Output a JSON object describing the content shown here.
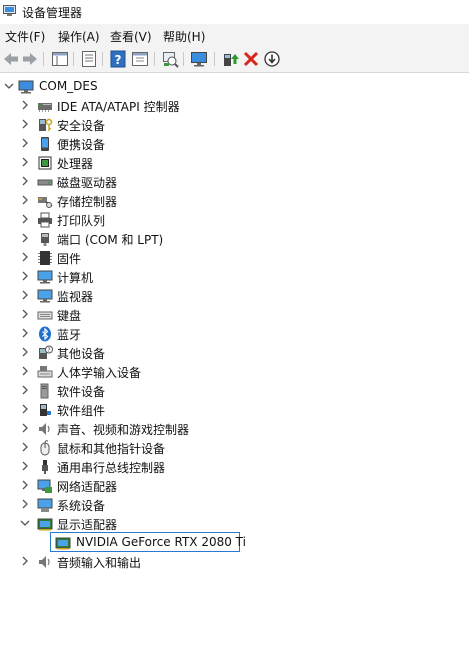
{
  "window": {
    "title": "设备管理器"
  },
  "menu": [
    "文件(F)",
    "操作(A)",
    "查看(V)",
    "帮助(H)"
  ],
  "toolbar": {
    "buttons": [
      "back-icon",
      "forward-icon",
      "show-hide-tree-icon",
      "properties-icon",
      "help-icon",
      "view-icon",
      "scan-hardware-icon",
      "monitor-icon",
      "update-driver-icon",
      "uninstall-icon",
      "disable-icon"
    ]
  },
  "tree": {
    "root": "COM_DES",
    "categories": [
      {
        "label": "IDE ATA/ATAPI 控制器",
        "icon": "ide-controller-icon"
      },
      {
        "label": "安全设备",
        "icon": "security-device-icon"
      },
      {
        "label": "便携设备",
        "icon": "portable-device-icon"
      },
      {
        "label": "处理器",
        "icon": "processor-icon"
      },
      {
        "label": "磁盘驱动器",
        "icon": "disk-drive-icon"
      },
      {
        "label": "存储控制器",
        "icon": "storage-controller-icon"
      },
      {
        "label": "打印队列",
        "icon": "print-queue-icon"
      },
      {
        "label": "端口 (COM 和 LPT)",
        "icon": "port-icon"
      },
      {
        "label": "固件",
        "icon": "firmware-icon"
      },
      {
        "label": "计算机",
        "icon": "computer-icon"
      },
      {
        "label": "监视器",
        "icon": "monitor-icon"
      },
      {
        "label": "键盘",
        "icon": "keyboard-icon"
      },
      {
        "label": "蓝牙",
        "icon": "bluetooth-icon"
      },
      {
        "label": "其他设备",
        "icon": "other-devices-icon"
      },
      {
        "label": "人体学输入设备",
        "icon": "hid-icon"
      },
      {
        "label": "软件设备",
        "icon": "software-device-icon"
      },
      {
        "label": "软件组件",
        "icon": "software-component-icon"
      },
      {
        "label": "声音、视频和游戏控制器",
        "icon": "sound-icon"
      },
      {
        "label": "鼠标和其他指针设备",
        "icon": "mouse-icon"
      },
      {
        "label": "通用串行总线控制器",
        "icon": "usb-icon"
      },
      {
        "label": "网络适配器",
        "icon": "network-adapter-icon"
      },
      {
        "label": "系统设备",
        "icon": "system-device-icon"
      },
      {
        "label": "显示适配器",
        "icon": "display-adapter-icon",
        "expanded": true,
        "children": [
          {
            "label": "NVIDIA GeForce RTX 2080 Ti",
            "icon": "display-adapter-icon",
            "selected": true
          }
        ]
      },
      {
        "label": "音频输入和输出",
        "icon": "audio-io-icon"
      }
    ]
  },
  "colors": {
    "selection_border": "#2a79d1",
    "toolbar_bg": "#f3f3f3"
  }
}
